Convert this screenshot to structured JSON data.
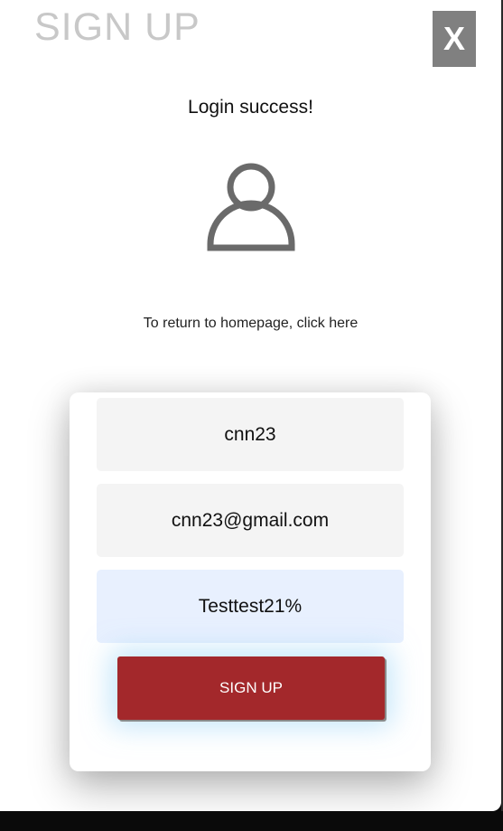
{
  "modal": {
    "title": "SIGN UP",
    "close_label": "X"
  },
  "status": {
    "message": "Login success!",
    "return_text": "To return to homepage, click here"
  },
  "icons": {
    "user": "user-icon"
  },
  "form": {
    "username_value": "cnn23",
    "email_value": "cnn23@gmail.com",
    "password_value": "Testtest21%",
    "submit_label": "SIGN UP"
  },
  "colors": {
    "submit_button": "#a3282b",
    "close_button": "#808080",
    "autofill_field": "#e8f0fe"
  }
}
